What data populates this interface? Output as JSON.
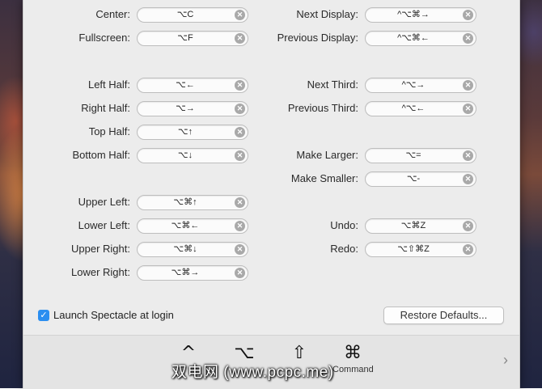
{
  "shortcuts_left": [
    {
      "label": "Center:",
      "value": "⌥C"
    },
    {
      "label": "Fullscreen:",
      "value": "⌥F"
    },
    {
      "label": "Left Half:",
      "value": "⌥←"
    },
    {
      "label": "Right Half:",
      "value": "⌥→"
    },
    {
      "label": "Top Half:",
      "value": "⌥↑"
    },
    {
      "label": "Bottom Half:",
      "value": "⌥↓"
    },
    {
      "label": "Upper Left:",
      "value": "⌥⌘↑"
    },
    {
      "label": "Lower Left:",
      "value": "⌥⌘←"
    },
    {
      "label": "Upper Right:",
      "value": "⌥⌘↓"
    },
    {
      "label": "Lower Right:",
      "value": "⌥⌘→"
    }
  ],
  "shortcuts_right": [
    {
      "label": "Next Display:",
      "value": "^⌥⌘→"
    },
    {
      "label": "Previous Display:",
      "value": "^⌥⌘←"
    },
    {
      "label": "Next Third:",
      "value": "^⌥→"
    },
    {
      "label": "Previous Third:",
      "value": "^⌥←"
    },
    {
      "label": "Make Larger:",
      "value": "⌥="
    },
    {
      "label": "Make Smaller:",
      "value": "⌥-"
    },
    {
      "label": "Undo:",
      "value": "⌥⌘Z"
    },
    {
      "label": "Redo:",
      "value": "⌥⇧⌘Z"
    }
  ],
  "clear_glyph": "✕",
  "launch_at_login": {
    "label": "Launch Spectacle at login",
    "checked": true,
    "check_glyph": "✓"
  },
  "restore_defaults_label": "Restore Defaults...",
  "modifier_keys": [
    {
      "glyph": "^",
      "name": ""
    },
    {
      "glyph": "⌥",
      "name": ""
    },
    {
      "glyph": "⇧",
      "name": ""
    },
    {
      "glyph": "⌘",
      "name": "Command"
    }
  ],
  "next_glyph": "›",
  "watermark": "双电网 (www.pcpc.me)"
}
